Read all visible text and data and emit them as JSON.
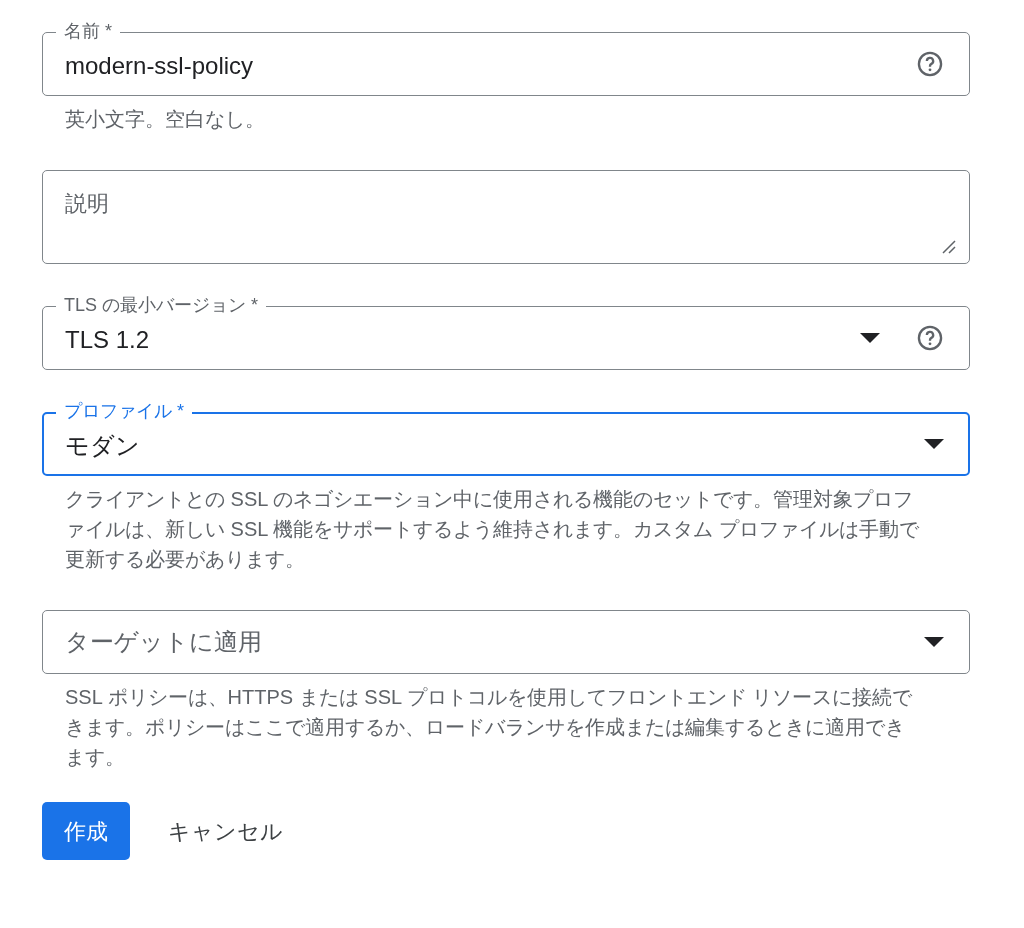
{
  "fields": [
    {
      "kind": "text",
      "label": "名前 *",
      "value": "modern-ssl-policy",
      "help_icon": true,
      "hint": "英小文字。空白なし。"
    },
    {
      "kind": "textarea",
      "placeholder": "説明"
    },
    {
      "kind": "select",
      "label": "TLS の最小バージョン *",
      "value": "TLS 1.2",
      "help_icon": true
    },
    {
      "kind": "select",
      "label": "プロファイル *",
      "value": "モダン",
      "focused": true,
      "hint": "クライアントとの SSL のネゴシエーション中に使用される機能のセットです。管理対象プロファイルは、新しい SSL 機能をサポートするよう維持されます。カスタム プロファイルは手動で更新する必要があります。"
    },
    {
      "kind": "select",
      "placeholder": "ターゲットに適用",
      "hint": "SSL ポリシーは、HTTPS または SSL プロトコルを使用してフロントエンド リソースに接続できます。ポリシーはここで適用するか、ロードバランサを作成または編集するときに適用できます。"
    }
  ],
  "buttons": [
    {
      "kind": "primary",
      "label": "作成"
    },
    {
      "kind": "text",
      "label": "キャンセル"
    }
  ]
}
